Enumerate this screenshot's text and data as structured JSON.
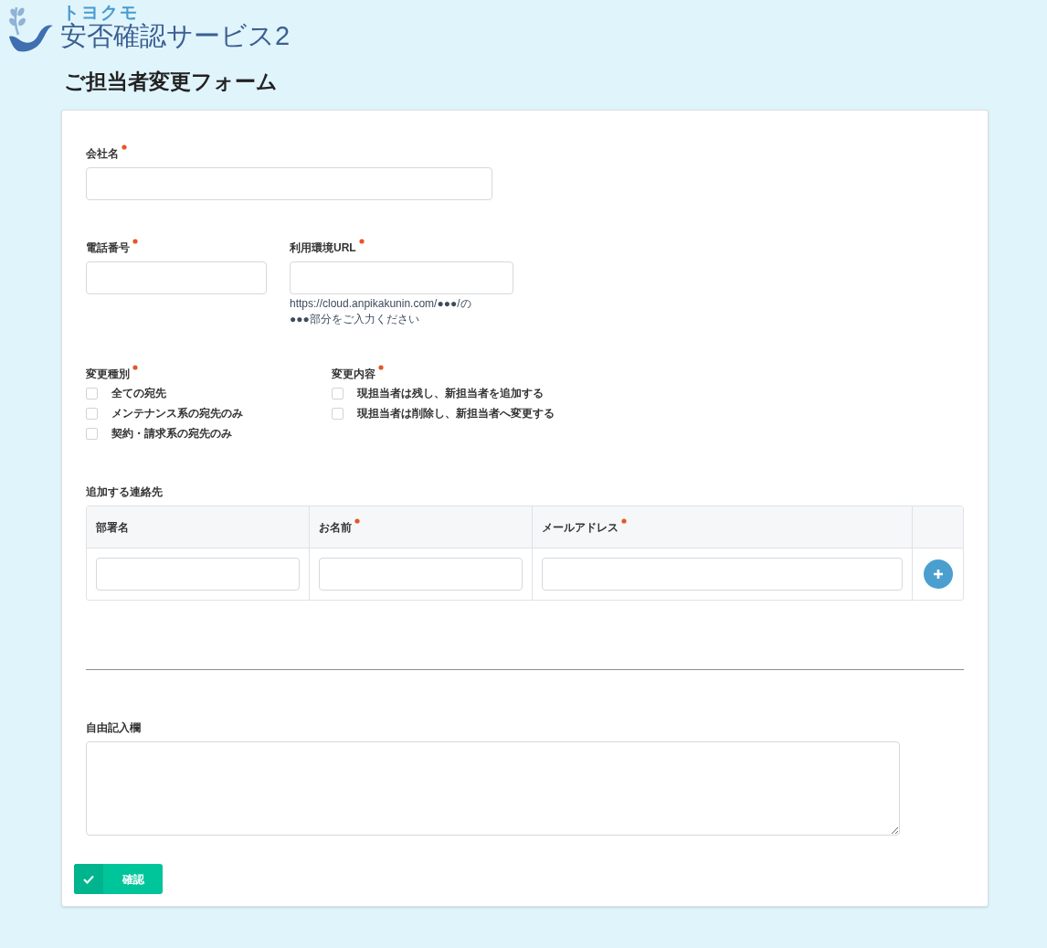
{
  "logo": {
    "brand": "トヨクモ",
    "product": "安否確認サービス2"
  },
  "title": "ご担当者変更フォーム",
  "company": {
    "label": "会社名",
    "required": true
  },
  "phone": {
    "label": "電話番号",
    "required": true
  },
  "url": {
    "label": "利用環境URL",
    "required": true,
    "help": [
      "https://cloud.anpikakunin.com/●●●/の",
      "●●●部分をご入力ください"
    ]
  },
  "change_type": {
    "label": "変更種別",
    "required": true,
    "options": [
      {
        "label": "全ての宛先",
        "checked": false
      },
      {
        "label": "メンテナンス系の宛先のみ",
        "checked": false
      },
      {
        "label": "契約・請求系の宛先のみ",
        "checked": false
      }
    ]
  },
  "change_content": {
    "label": "変更内容",
    "required": true,
    "options": [
      {
        "label": "現担当者は残し、新担当者を追加する",
        "checked": false
      },
      {
        "label": "現担当者は削除し、新担当者へ変更する",
        "checked": false
      }
    ]
  },
  "contacts": {
    "label": "追加する連絡先",
    "columns": [
      {
        "label": "部署名",
        "required": false
      },
      {
        "label": "お名前",
        "required": true
      },
      {
        "label": "メールアドレス",
        "required": true
      }
    ]
  },
  "notes": {
    "label": "自由記入欄",
    "required": false
  },
  "submit": {
    "label": "確認"
  }
}
